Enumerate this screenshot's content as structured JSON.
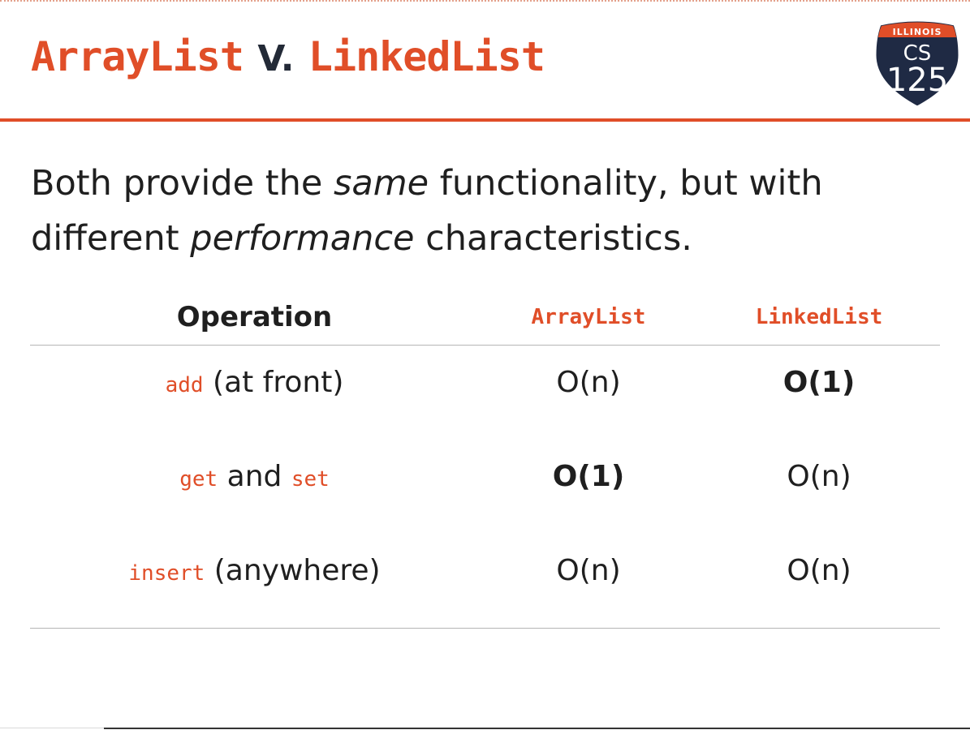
{
  "slide": {
    "title": {
      "left_code": "ArrayList",
      "separator": "V.",
      "right_code": "LinkedList"
    },
    "logo": {
      "top_text": "ILLINOIS",
      "line1": "CS",
      "line2": "125",
      "colors": {
        "shield": "#1f2a44",
        "banner": "#e04e28",
        "text": "#ffffff"
      }
    },
    "intro": {
      "part1": "Both provide the ",
      "em1": "same",
      "part2": " functionality, but with different ",
      "em2": "performance",
      "part3": " characteristics."
    },
    "table": {
      "headers": [
        "Operation",
        "ArrayList",
        "LinkedList"
      ],
      "rows": [
        {
          "op_code1": "add",
          "op_text1": " (at front)",
          "op_code2": "",
          "op_text2": "",
          "arraylist": "O(n)",
          "linkedlist": "O(1)",
          "bold": "linkedlist"
        },
        {
          "op_code1": "get",
          "op_text1": " and ",
          "op_code2": "set",
          "op_text2": "",
          "arraylist": "O(1)",
          "linkedlist": "O(n)",
          "bold": "arraylist"
        },
        {
          "op_code1": "insert",
          "op_text1": " (anywhere)",
          "op_code2": "",
          "op_text2": "",
          "arraylist": "O(n)",
          "linkedlist": "O(n)",
          "bold": ""
        }
      ]
    },
    "colors": {
      "accent": "#e04e28",
      "text": "#1f1f1f",
      "rule": "#b5b5b5"
    }
  }
}
